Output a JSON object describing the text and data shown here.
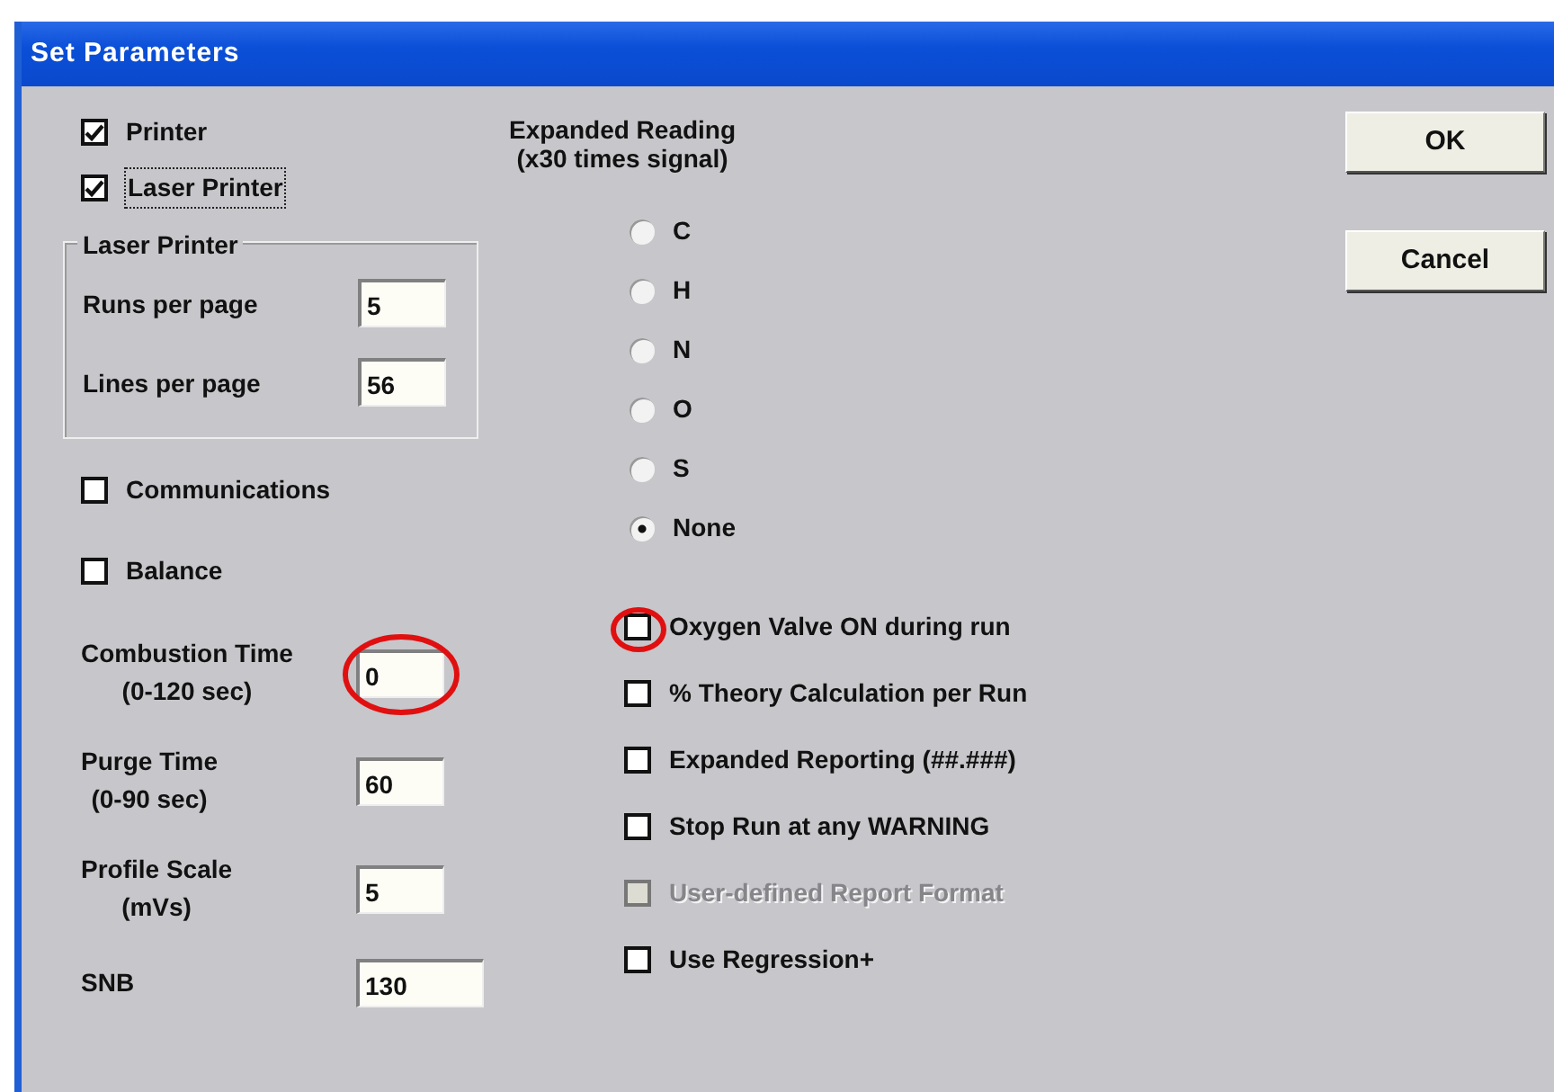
{
  "window": {
    "title": "Set Parameters"
  },
  "printer_options": [
    {
      "label": "Printer",
      "checked": true,
      "focused": false
    },
    {
      "label": "Laser Printer",
      "checked": true,
      "focused": true
    }
  ],
  "laser_printer_group": {
    "title": "Laser Printer",
    "fields": [
      {
        "label": "Runs per page",
        "value": "5"
      },
      {
        "label": "Lines per page",
        "value": "56"
      }
    ]
  },
  "device_options": [
    {
      "label": "Communications",
      "checked": false
    },
    {
      "label": "Balance",
      "checked": false
    }
  ],
  "time_fields": [
    {
      "label": "Combustion Time",
      "sublabel": "(0-120 sec)",
      "value": "0",
      "circled": true,
      "wide": false
    },
    {
      "label": "Purge Time",
      "sublabel": "(0-90 sec)",
      "value": "60",
      "circled": false,
      "wide": false
    },
    {
      "label": "Profile Scale",
      "sublabel": "(mVs)",
      "value": "5",
      "circled": false,
      "wide": false
    },
    {
      "label": "SNB",
      "value": "130",
      "circled": false,
      "wide": true
    }
  ],
  "expanded_reading": {
    "title": "Expanded Reading",
    "subtitle": "(x30 times signal)",
    "options": [
      {
        "label": "C",
        "selected": false
      },
      {
        "label": "H",
        "selected": false
      },
      {
        "label": "N",
        "selected": false
      },
      {
        "label": "O",
        "selected": false
      },
      {
        "label": "S",
        "selected": false
      },
      {
        "label": "None",
        "selected": true
      }
    ]
  },
  "run_options": [
    {
      "label": "Oxygen Valve ON during run",
      "checked": false,
      "disabled": false,
      "circled": true
    },
    {
      "label": "% Theory Calculation per Run",
      "checked": false,
      "disabled": false,
      "circled": false
    },
    {
      "label": "Expanded Reporting (##.###)",
      "checked": false,
      "disabled": false,
      "circled": false
    },
    {
      "label": "Stop Run at any WARNING",
      "checked": false,
      "disabled": false,
      "circled": false
    },
    {
      "label": "User-defined Report Format",
      "checked": false,
      "disabled": true,
      "circled": false
    },
    {
      "label": "Use Regression+",
      "checked": false,
      "disabled": false,
      "circled": false
    }
  ],
  "buttons": [
    {
      "label": "OK"
    },
    {
      "label": "Cancel"
    }
  ]
}
